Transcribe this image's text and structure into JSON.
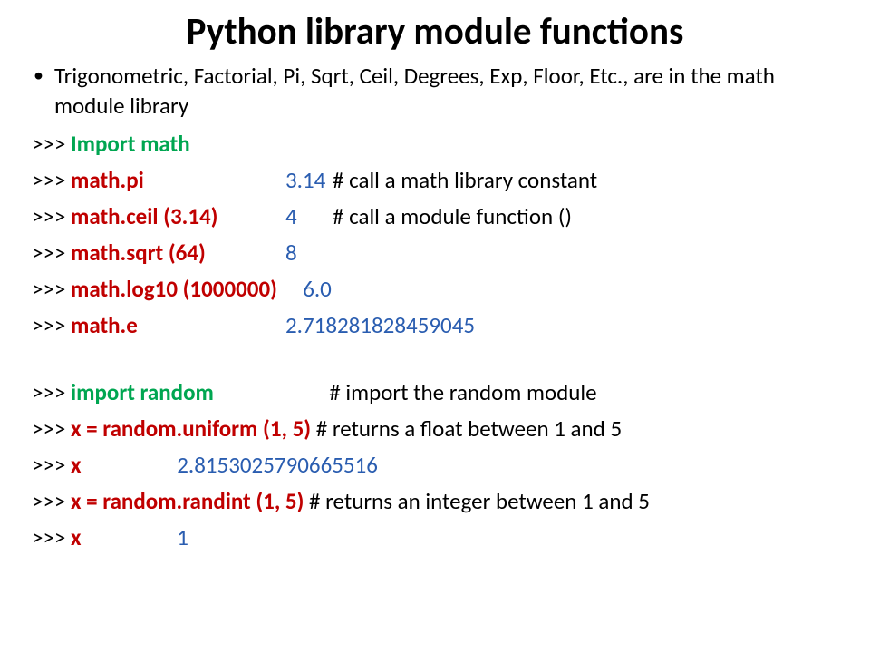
{
  "title": "Python library module functions",
  "intro": "Trigonometric, Factorial, Pi, Sqrt, Ceil, Degrees, Exp, Floor, Etc., are in the math module library",
  "l1": {
    "p": ">>>",
    "cmd": "Import math"
  },
  "l2": {
    "p": ">>>",
    "cmd": "math.pi",
    "val": "3.14",
    "c": "# call a math library constant"
  },
  "l3": {
    "p": ">>>",
    "cmd": "math.ceil (3.14)",
    "val": "4",
    "c": "# call a module function ()"
  },
  "l4": {
    "p": ">>>",
    "cmd": "math.sqrt (64)",
    "val": "8"
  },
  "l5": {
    "p": ">>>",
    "cmd": "math.log10 (1000000)",
    "val": "6.0"
  },
  "l6": {
    "p": ">>>",
    "cmd": "math.e",
    "val": "2.718281828459045"
  },
  "l7": {
    "p": ">>>",
    "cmd": "import random",
    "c": "# import the random module"
  },
  "l8": {
    "p": ">>>",
    "cmd": "x = random.uniform (1, 5)",
    "c": " # returns a float between 1 and 5"
  },
  "l9": {
    "p": ">>>",
    "cmd": "x",
    "val": "2.8153025790665516"
  },
  "l10": {
    "p": ">>>",
    "cmd": "x = random.randint (1, 5)",
    "c": "  # returns an integer between 1 and 5"
  },
  "l11": {
    "p": ">>>",
    "cmd": "x",
    "val": "1"
  }
}
